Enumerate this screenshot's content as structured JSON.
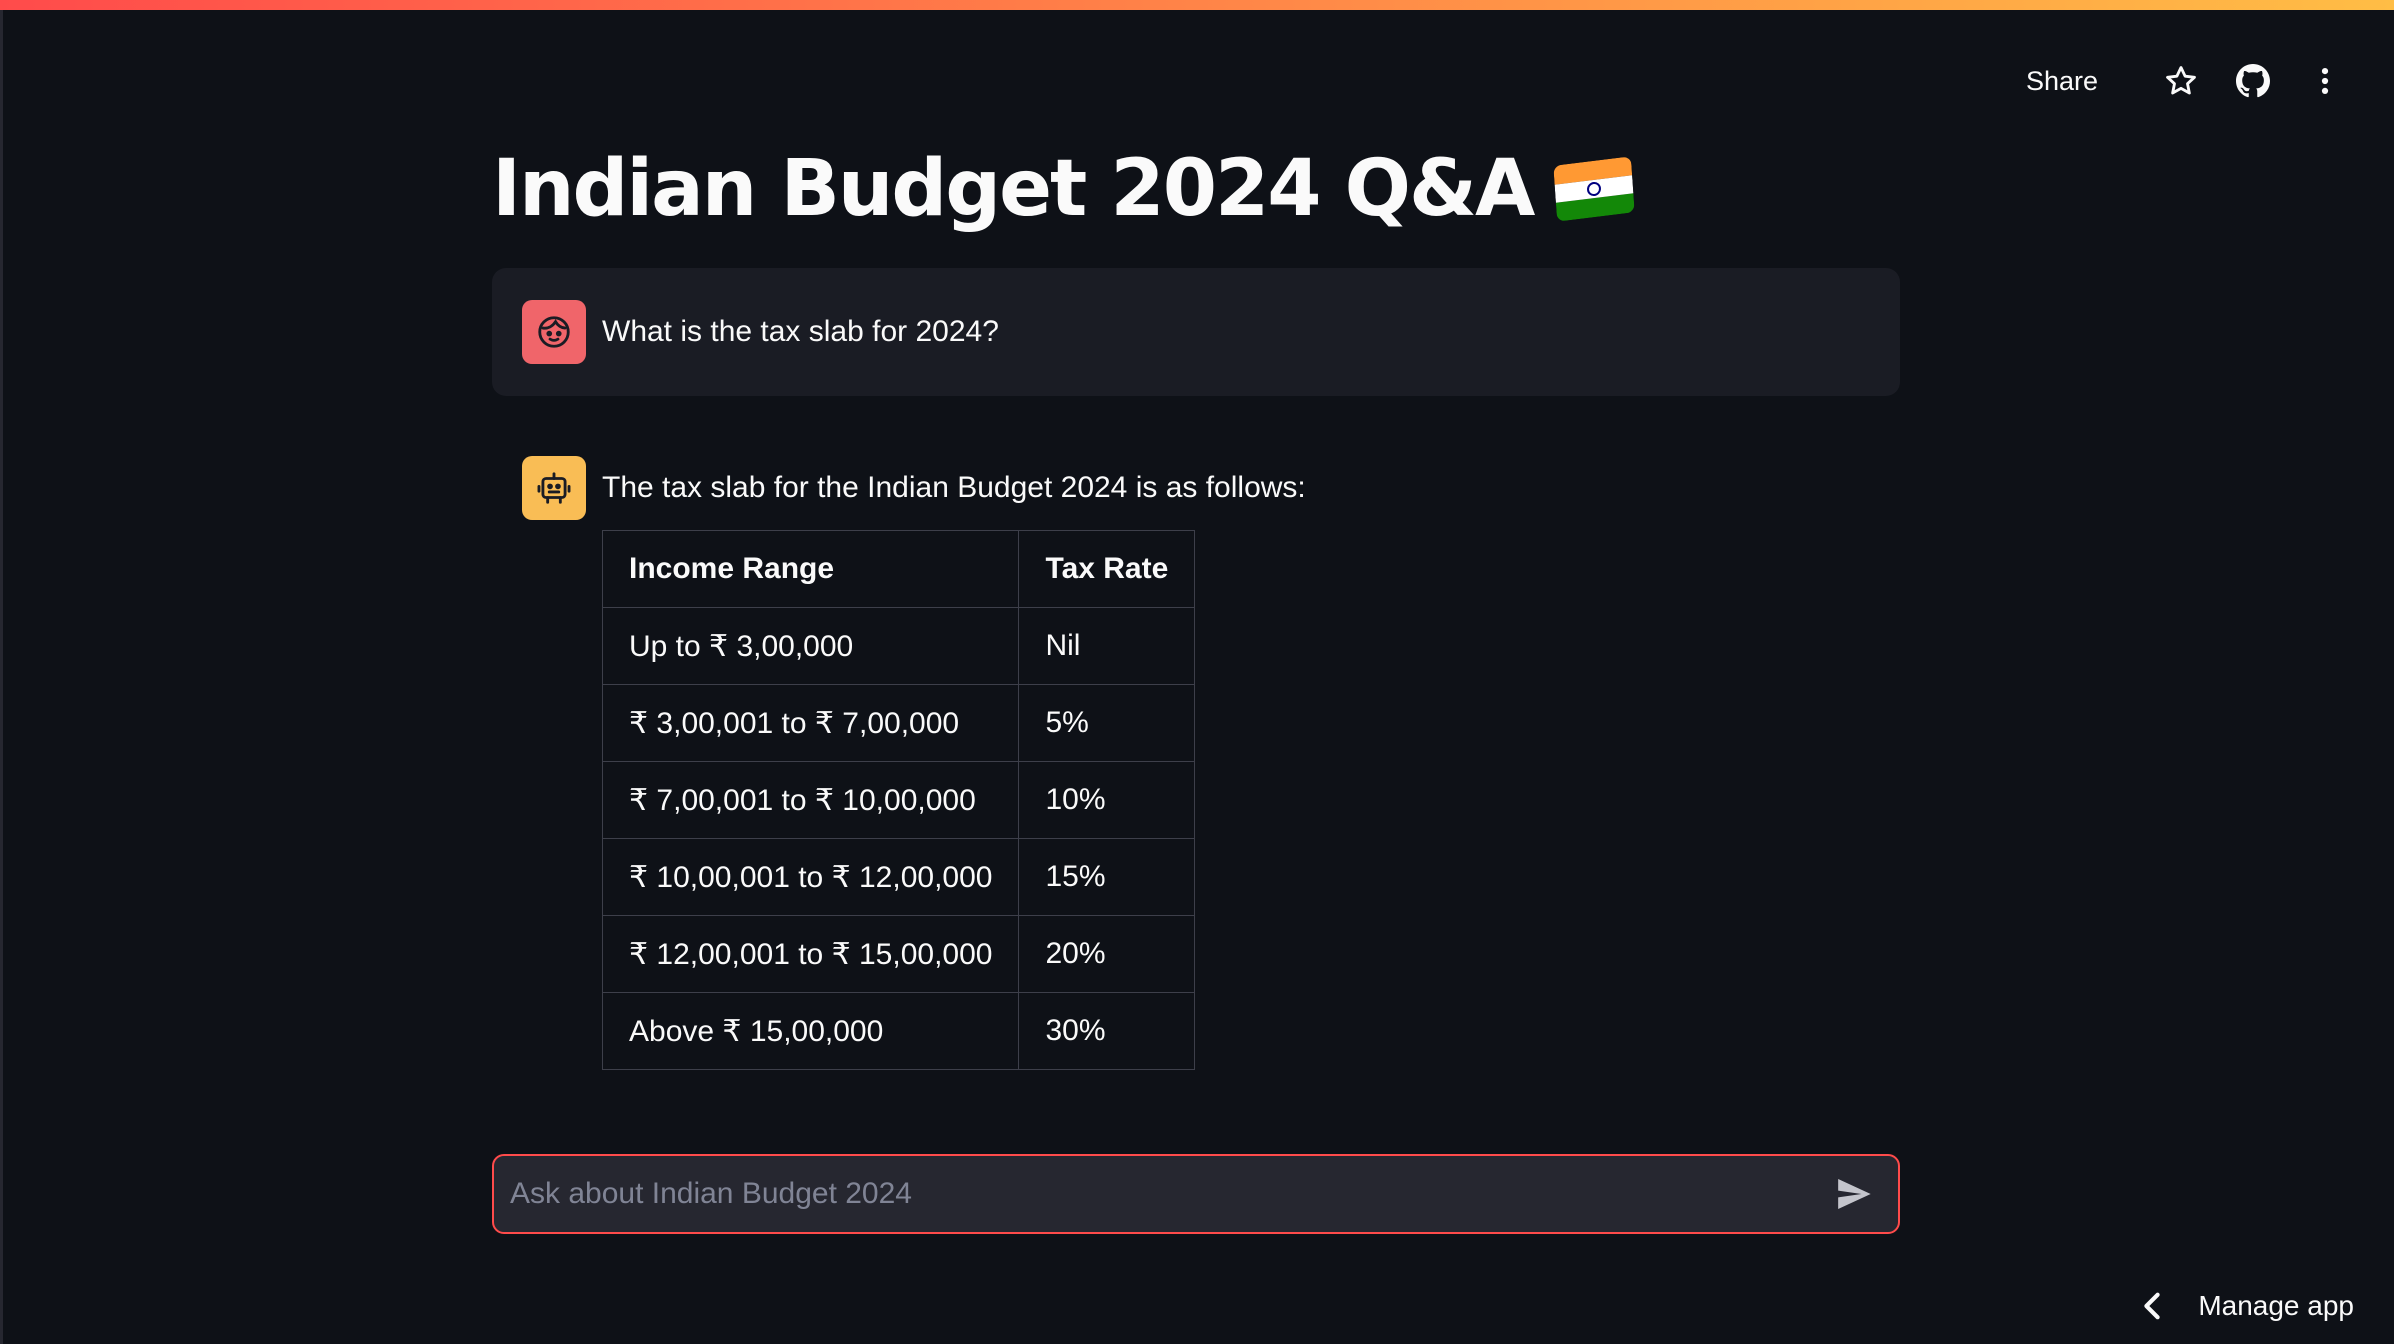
{
  "header": {
    "share_label": "Share",
    "icons": [
      "star-icon",
      "github-icon",
      "more-vertical-icon"
    ]
  },
  "page": {
    "title": "Indian Budget 2024 Q&A",
    "title_emoji": "india-flag-icon"
  },
  "messages": {
    "user": {
      "avatar": "user-face-icon",
      "text": "What is the tax slab for 2024?"
    },
    "assistant": {
      "avatar": "robot-icon",
      "text": "The tax slab for the Indian Budget 2024 is as follows:",
      "table": {
        "headers": [
          "Income Range",
          "Tax Rate"
        ],
        "rows": [
          [
            "Up to ₹ 3,00,000",
            "Nil"
          ],
          [
            "₹ 3,00,001 to ₹ 7,00,000",
            "5%"
          ],
          [
            "₹ 7,00,001 to ₹ 10,00,000",
            "10%"
          ],
          [
            "₹ 10,00,001 to ₹ 12,00,000",
            "15%"
          ],
          [
            "₹ 12,00,001 to ₹ 15,00,000",
            "20%"
          ],
          [
            "Above ₹ 15,00,000",
            "30%"
          ]
        ]
      }
    }
  },
  "chat_input": {
    "placeholder": "Ask about Indian Budget 2024",
    "value": ""
  },
  "footer": {
    "manage_app_label": "Manage app"
  },
  "colors": {
    "background": "#0e1117",
    "accent": "#ff4b4b",
    "user_avatar": "#f0656a",
    "bot_avatar": "#f9bd55"
  }
}
